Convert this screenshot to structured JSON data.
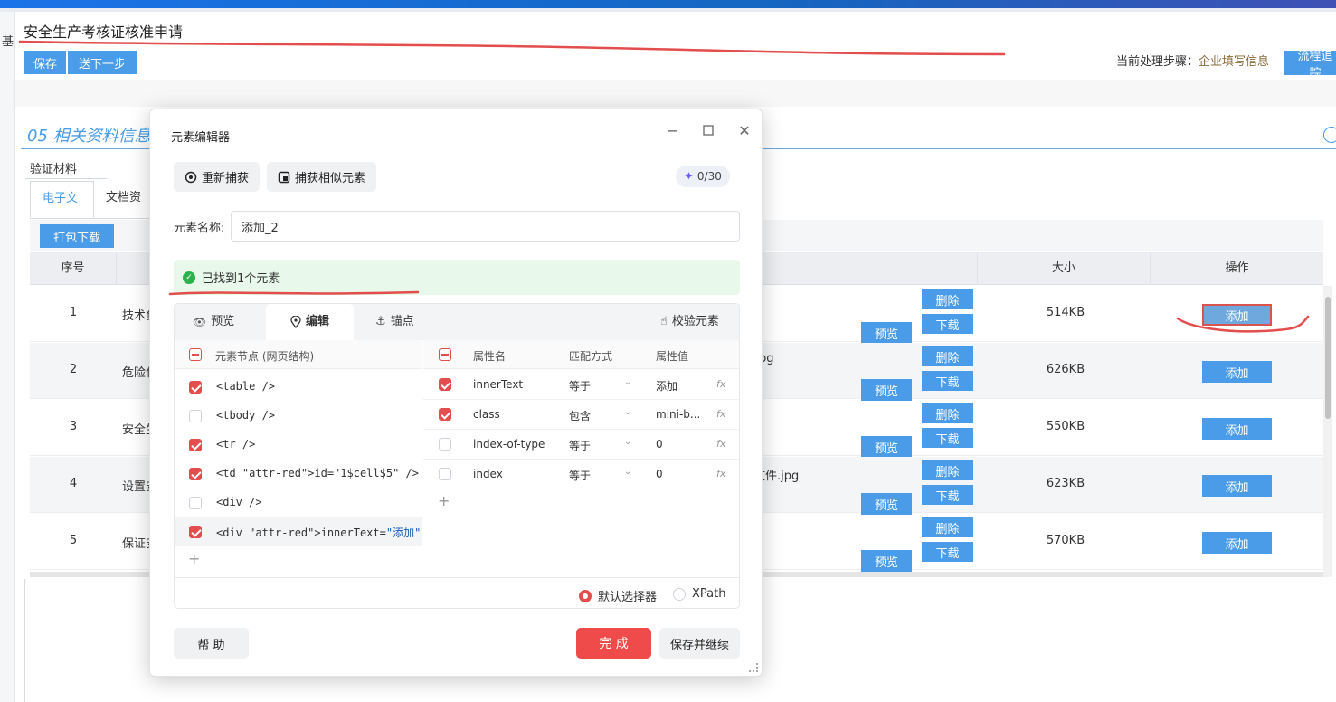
{
  "page": {
    "left_strip_text": "基",
    "title": "安全生产考核证核准申请",
    "toolbar": {
      "save": "保存",
      "send_next": "送下一步"
    },
    "step_label": "当前处理步骤：",
    "step_value": "企业填写信息",
    "flow_button": "流程追踪",
    "section_title": "05 相关资料信息",
    "verify_label": "验证材料",
    "tabs": [
      "电子文档",
      "文档资料"
    ],
    "pack_download": "打包下载",
    "table": {
      "headers": {
        "index": "序号",
        "size": "大小",
        "action": "操作"
      },
      "rows": [
        {
          "index": "1",
          "name": "技术负",
          "file": "",
          "size": "514KB"
        },
        {
          "index": "2",
          "name": "危险化",
          "file": "pg",
          "size": "626KB"
        },
        {
          "index": "3",
          "name": "安全生",
          "file": "",
          "size": "550KB"
        },
        {
          "index": "4",
          "name": "设置安",
          "file": "文件.jpg",
          "size": "623KB"
        },
        {
          "index": "5",
          "name": "保证安",
          "file": "",
          "size": "570KB"
        }
      ],
      "preview_label": "预览",
      "delete_label": "删除",
      "download_label": "下载",
      "add_label": "添加"
    }
  },
  "modal": {
    "title": "元素编辑器",
    "recapture": "重新捕获",
    "capture_similar": "捕获相似元素",
    "counter": "0/30",
    "name_label": "元素名称:",
    "name_value": "添加_2",
    "found_text": "已找到1个元素",
    "tabs": {
      "preview": "预览",
      "edit": "编辑",
      "anchor": "锚点",
      "verify": "校验元素"
    },
    "nodes_header": "元素节点 (网页结构)",
    "nodes": [
      {
        "text": "<table />",
        "checked": true
      },
      {
        "text": "<tbody />",
        "checked": false
      },
      {
        "text": "<tr />",
        "checked": true
      },
      {
        "text": "<td id=\"1$cell$5\" />",
        "checked": true
      },
      {
        "text": "<div />",
        "checked": false
      },
      {
        "text": "<div innerText=\"添加\" contains:class=...",
        "checked": true
      }
    ],
    "attr_headers": {
      "name": "属性名",
      "match": "匹配方式",
      "value": "属性值"
    },
    "attrs": [
      {
        "name": "innerText",
        "match": "等于",
        "value": "添加",
        "checked": true
      },
      {
        "name": "class",
        "match": "包含",
        "value": "mini-b...",
        "checked": true
      },
      {
        "name": "index-of-type",
        "match": "等于",
        "value": "0",
        "checked": false
      },
      {
        "name": "index",
        "match": "等于",
        "value": "0",
        "checked": false
      }
    ],
    "fx": "fx",
    "selector_default": "默认选择器",
    "selector_xpath": "XPath",
    "help": "帮 助",
    "done": "完 成",
    "save_continue": "保存并继续"
  },
  "colors": {
    "accent_blue": "#4a9be8",
    "primary_red": "#f04b4b",
    "success_green": "#2bb24c"
  }
}
